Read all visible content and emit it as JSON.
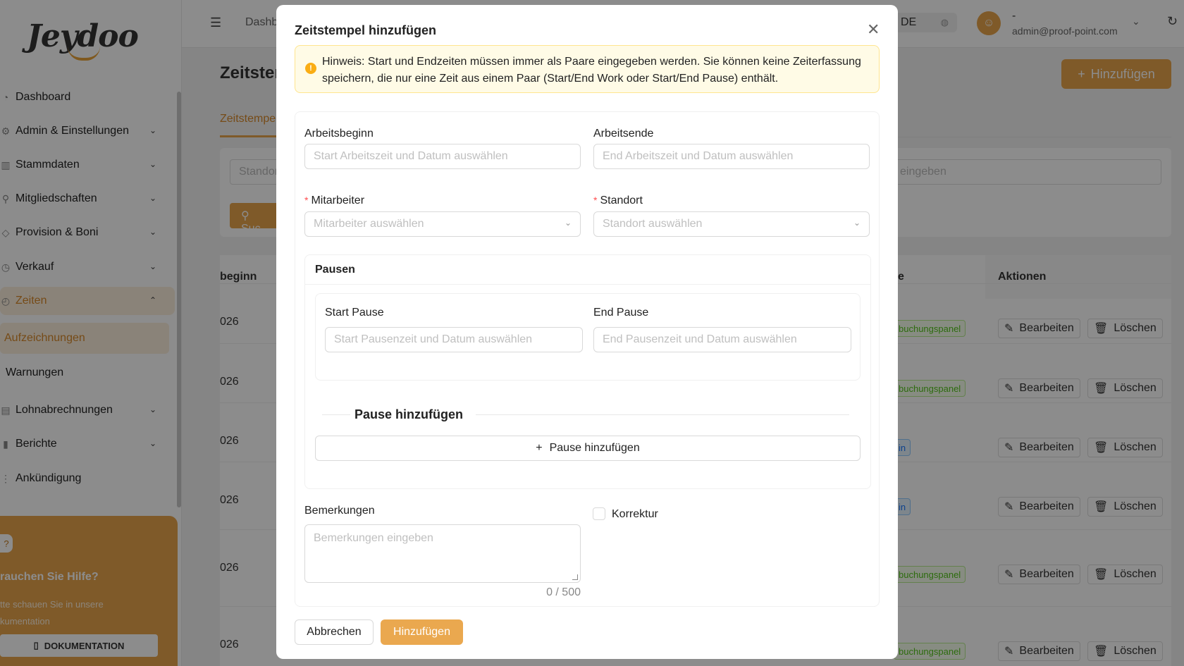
{
  "brand": {
    "logo_text": "Jeydoo"
  },
  "sidebar": {
    "items": [
      {
        "label": "Dashboard",
        "icon": "dashboard-icon"
      },
      {
        "label": "Admin & Einstellungen",
        "icon": "settings-icon"
      },
      {
        "label": "Stammdaten",
        "icon": "building-icon"
      },
      {
        "label": "Mitgliedschaften",
        "icon": "members-icon"
      },
      {
        "label": "Provision & Boni",
        "icon": "bonus-icon"
      },
      {
        "label": "Verkauf",
        "icon": "sales-icon"
      },
      {
        "label": "Zeiten",
        "icon": "clock-icon"
      },
      {
        "label": "Lohnabrechnungen",
        "icon": "payroll-icon"
      },
      {
        "label": "Berichte",
        "icon": "chart-icon"
      },
      {
        "label": "Ankündigung",
        "icon": "announcement-icon"
      }
    ],
    "subitems": [
      {
        "label": "Aufzeichnungen"
      },
      {
        "label": "Warnungen"
      }
    ],
    "help": {
      "title": "rauchen Sie Hilfe?",
      "text_line1": "tte schauen Sie in unsere",
      "text_line2": "kumentation",
      "button": "DOKUMENTATION"
    }
  },
  "topbar": {
    "breadcrumb": "Dashb",
    "language": "DE",
    "user_name": "-",
    "user_email": "admin@proof-point.com"
  },
  "page": {
    "title": "Zeitster",
    "add_button": "Hinzufügen",
    "tab": "Zeitstempe",
    "filter_left_placeholder": "Standor",
    "filter_right_placeholder": "eingeben",
    "search_button": "Suc"
  },
  "table": {
    "headers": {
      "col1": "beginn",
      "col_status": "e",
      "actions": "Aktionen"
    },
    "rows": [
      {
        "date": "026",
        "tag": "buchungspanel",
        "tag_color": "green"
      },
      {
        "date": "026",
        "tag": "buchungspanel",
        "tag_color": "green"
      },
      {
        "date": "026",
        "tag": "in",
        "tag_color": "blue"
      },
      {
        "date": "026",
        "tag": "in",
        "tag_color": "blue"
      },
      {
        "date": "026",
        "tag": "buchungspanel",
        "tag_color": "green"
      },
      {
        "date": "026",
        "tag": "buchungspanel",
        "tag_color": "green"
      }
    ],
    "edit_label": "Bearbeiten",
    "delete_label": "Löschen"
  },
  "modal": {
    "title": "Zeitstempel hinzufügen",
    "alert": "Hinweis: Start und Endzeiten müssen immer als Paare eingegeben werden. Sie können keine Zeiterfassung speichern, die nur eine Zeit aus einem Paar (Start/End Work oder Start/End Pause) enthält.",
    "work_start_label": "Arbeitsbeginn",
    "work_start_placeholder": "Start Arbeitszeit und Datum auswählen",
    "work_end_label": "Arbeitsende",
    "work_end_placeholder": "End Arbeitszeit und Datum auswählen",
    "employee_label": "Mitarbeiter",
    "employee_placeholder": "Mitarbeiter auswählen",
    "location_label": "Standort",
    "location_placeholder": "Standort auswählen",
    "required_mark": "*",
    "breaks_title": "Pausen",
    "break_start_label": "Start Pause",
    "break_start_placeholder": "Start Pausenzeit und Datum auswählen",
    "break_end_label": "End Pause",
    "break_end_placeholder": "End Pausenzeit und Datum auswählen",
    "add_break_divider": "Pause hinzufügen",
    "add_break_button": "Pause hinzufügen",
    "remarks_label": "Bemerkungen",
    "remarks_placeholder": "Bemerkungen eingeben",
    "remarks_counter": "0 / 500",
    "correction_label": "Korrektur",
    "cancel_button": "Abbrechen",
    "submit_button": "Hinzufügen"
  },
  "colors": {
    "accent": "#e8a54c",
    "accent_text": "#d7892a",
    "warning_bg": "#fffbe6",
    "warning_border": "#ffe58f",
    "required": "#ff4d4f"
  }
}
